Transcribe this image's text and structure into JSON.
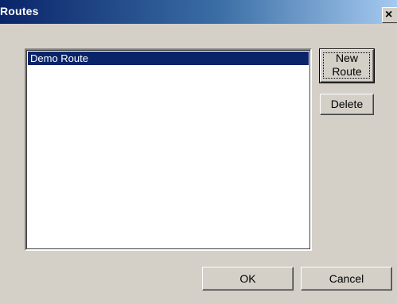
{
  "window": {
    "title": "Routes",
    "close_glyph": "×"
  },
  "routes_list": {
    "items": [
      {
        "label": "Demo Route",
        "selected": true
      }
    ]
  },
  "buttons": {
    "new_route_line1": "New",
    "new_route_line2": "Route",
    "delete": "Delete",
    "ok": "OK",
    "cancel": "Cancel"
  },
  "colors": {
    "dialog_face": "#d4d0c8",
    "title_gradient_start": "#0a246a",
    "title_gradient_end": "#a6caf0",
    "selection": "#0a246a",
    "list_background": "#ffffff"
  },
  "icons": {
    "close": "close-icon"
  }
}
